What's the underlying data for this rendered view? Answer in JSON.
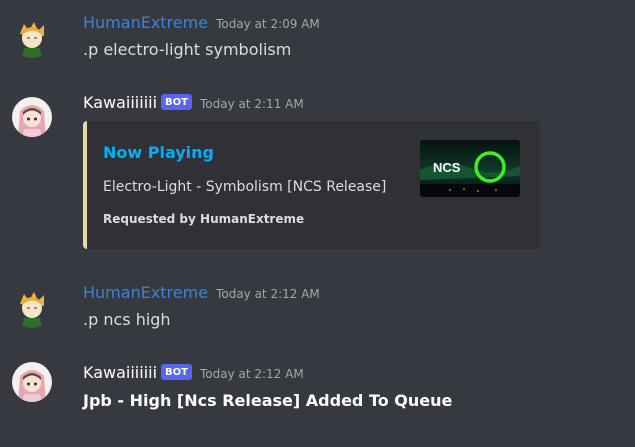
{
  "messages": [
    {
      "author": "HumanExtreme",
      "timestamp": "Today at 2:09 AM",
      "content": ".p electro-light symbolism"
    },
    {
      "author": "Kawaiiiiiii",
      "bot_tag": "BOT",
      "timestamp": "Today at 2:11 AM",
      "embed": {
        "title": "Now Playing",
        "description": "Electro-Light - Symbolism [NCS Release]",
        "footer": "Requested by HumanExtreme",
        "thumbnail_logo": "NCS",
        "accent_color": "#e8d8a2"
      }
    },
    {
      "author": "HumanExtreme",
      "timestamp": "Today at 2:12 AM",
      "content": ".p ncs high"
    },
    {
      "author": "Kawaiiiiiii",
      "bot_tag": "BOT",
      "timestamp": "Today at 2:12 AM",
      "content": "Jpb - High [Ncs Release] Added To Queue"
    }
  ],
  "colors": {
    "background": "#36393f",
    "embed_background": "#2f3136",
    "human_username": "#3b83d8",
    "bot_tag": "#5865f2",
    "embed_title": "#00aff4"
  }
}
